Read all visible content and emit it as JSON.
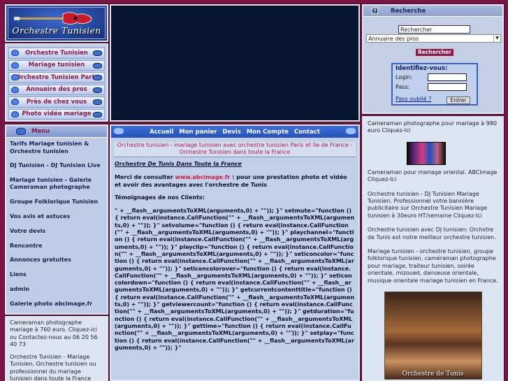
{
  "logo": {
    "text": "Orchestre Tunisien",
    "icon": "guitar-icon"
  },
  "nav": {
    "items": [
      {
        "label": "Orchestre Tunisien"
      },
      {
        "label": "Mariage tunisien"
      },
      {
        "label": "Orchestre Tunisien Paris"
      },
      {
        "label": "Annuaire des pros"
      },
      {
        "label": "Près de chez vous"
      },
      {
        "label": "Photo vidéo mariage"
      }
    ]
  },
  "menu": {
    "title": "Menu",
    "items": [
      {
        "label": "Tarifs Mariage tunisien & Orchestre tunisien"
      },
      {
        "label": "DJ Tunisien - DJ Tunisien Live"
      },
      {
        "label": "Mariage tunisien - Galerie Cameraman photographe"
      },
      {
        "label": "Groupe Folklorique Tunisien"
      },
      {
        "label": "Vos avis et astuces"
      },
      {
        "label": "Votre devis"
      },
      {
        "label": "Rencontre"
      },
      {
        "label": "Annonces gratuites"
      },
      {
        "label": "Liens"
      },
      {
        "label": "admin"
      },
      {
        "label": "Galerie photo abcimage.fr"
      }
    ]
  },
  "left_text": {
    "p1": "Cameraman photographe mariage à 760 euro. Cliquez-ici ou Contactez-nous au 06 20 56 40 73",
    "p2": "Orchestre Tunisien - Mariage Tunisien. Orchestre tunisien ou professionnel du mariage tunisien dans toute la France"
  },
  "search": {
    "title": "Recherche",
    "input_value": "Rechercher",
    "select_value": "Annuaire des pros",
    "button": "Rechercher"
  },
  "login": {
    "title": "Identifiez-vous:",
    "login_label": "Login:",
    "pass_label": "Pass:",
    "forgot": "Pass oublié ?",
    "enter": "Entrer"
  },
  "topnav": {
    "links": [
      {
        "label": "Accueil"
      },
      {
        "label": "Mon panier"
      },
      {
        "label": "Devis"
      },
      {
        "label": "Mon Compte"
      },
      {
        "label": "Contact"
      }
    ]
  },
  "content": {
    "title": "Orchestre tunisien - mariage tunisien avec orchestre tunisien Paris et Ile de France -Orchestre Tunisien dans toute la France",
    "subtitle": "Orchestre De Tunis Dans Toute la France",
    "intro_pre": "Merci de consulter ",
    "intro_link": "www.abcimage.fr",
    "intro_post": " : pour une prestation photo et vidéo et avoir des avantages avec l'orchestre de Tunis",
    "testimonials": "Témoignages de nos Clients:",
    "code": "\" + __flash__argumentsToXML(arguments,0) + \"\")); }\" setmute=\"function () { return eval(instance.CallFunction(\"\" + __flash__argumentsToXML(arguments,0) + \"\")); }\" setvolume=\"function () { return eval(instance.CallFunction(\"\" + __flash__argumentsToXML(arguments,0) + \"\")); }\" playchannel=\"function () { return eval(instance.CallFunction(\"\" + __flash__argumentsToXML(arguments,0) + \"\")); }\" playclip=\"function () { return eval(instance.CallFunction(\"\" + __flash__argumentsToXML(arguments,0) + \"\")); }\" seticoncolor=\"function () { return eval(instance.CallFunction(\"\" + __flash__argumentsToXML(arguments,0) + \"\")); }\" seticoncolorover=\"function () { return eval(instance.CallFunction(\"\" + __flash__argumentsToXML(arguments,0) + \"\")); }\" seticoncolordown=\"function () { return eval(instance.CallFunction(\"\" + __flash__argumentsToXML(arguments,0) + \"\")); }\" getcurrentcontenttitle=\"function () { return eval(instance.CallFunction(\"\" + __flash__argumentsToXML(arguments,0) + \"\")); }\" getviewercount=\"function () { return eval(instance.CallFunction(\"\" + __flash__argumentsToXML(arguments,0) + \"\")); }\" getduration=\"function () { return eval(instance.CallFunction(\"\" + __flash__argumentsToXML(arguments,0) + \"\")); }\" gettime=\"function () { return eval(instance.CallFunction(\"\" + __flash__argumentsToXML(arguments,0) + \"\")); }\" setplay=\"function () { return eval(instance.CallFunction(\"\" + __flash__argumentsToXML(arguments,0) + \"\")); }\""
  },
  "right": {
    "p1": "Cameraman photographe pour mariage à 980 euro Cliquez-Ici",
    "p2": "Cameraman pour mariage oriental. ABCImage Cliquez-Ici",
    "p3": "Orchestre tunisien - DJ Tunisien Mariage Tunisien. Professionnel votre bannière publicitaire sur Orchestre Tunisien Mariage tunisien à 30euro HT/semaine Cliquez-Ici",
    "p4": "Orchestre tunisien avec DJ tunisien: Orchstre de Tunis est notre meilleur orchestre tunisien.",
    "p5": "Mariage tunisien - orchestre tunisien, groupe folklorique tunisien, caméraman photographe pour mariage, traiteur tunisien, soirée orientale, mizoued, danseuse orientale, musique orientale mariage tunisien en France.",
    "photo_caption": "Orchestre de Tunis"
  }
}
